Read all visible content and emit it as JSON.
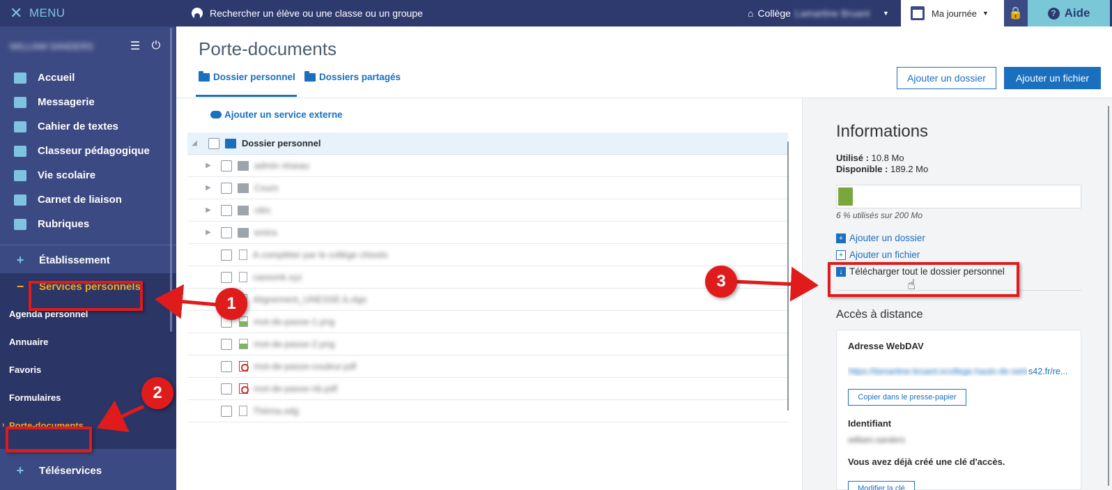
{
  "sidebar": {
    "menu_label": "MENU",
    "user_name": "WILLIAM SANDERS",
    "nav_items": [
      {
        "label": "Accueil",
        "icon": "grid-icon"
      },
      {
        "label": "Messagerie",
        "icon": "envelope-icon"
      },
      {
        "label": "Cahier de textes",
        "icon": "notebook-icon"
      },
      {
        "label": "Classeur pédagogique",
        "icon": "binder-icon"
      },
      {
        "label": "Vie scolaire",
        "icon": "pie-icon"
      },
      {
        "label": "Carnet de liaison",
        "icon": "link-icon"
      },
      {
        "label": "Rubriques",
        "icon": "chat-icon"
      }
    ],
    "etablissement": "Établissement",
    "services_personnels": "Services personnels",
    "sub_items": [
      "Agenda personnel",
      "Annuaire",
      "Favoris",
      "Formulaires",
      "Porte-documents"
    ],
    "teleservices": "Téléservices"
  },
  "topbar": {
    "search_placeholder": "Rechercher un élève ou une classe ou un groupe",
    "college_label": "Collège",
    "college_name": "Lamartine Bruant",
    "journee_label": "Ma journée",
    "aide_label": "Aide"
  },
  "main": {
    "page_title": "Porte-documents",
    "tab_personal": "Dossier personnel",
    "tab_shared": "Dossiers partagés",
    "btn_add_folder": "Ajouter un dossier",
    "btn_add_file": "Ajouter un fichier",
    "add_external": "Ajouter un service externe",
    "root_folder": "Dossier personnel",
    "rows": [
      {
        "type": "folder",
        "name": "admin réseau",
        "expandable": true
      },
      {
        "type": "folder",
        "name": "Cours",
        "expandable": true
      },
      {
        "type": "folder",
        "name": "clés",
        "expandable": true
      },
      {
        "type": "folder",
        "name": "emira",
        "expandable": true
      },
      {
        "type": "doc",
        "name": "A compléter par le collège chiosts",
        "expandable": false
      },
      {
        "type": "doc",
        "name": "cassonk.xyz",
        "expandable": false
      },
      {
        "type": "doc",
        "name": "Alignement_UNESSE.b.xlgs",
        "expandable": false
      },
      {
        "type": "img",
        "name": "mot-de-passe-1.png",
        "expandable": false
      },
      {
        "type": "img",
        "name": "mot-de-passe-2.png",
        "expandable": false
      },
      {
        "type": "pdf",
        "name": "mot-de-passe-couleur.pdf",
        "expandable": false
      },
      {
        "type": "pdf",
        "name": "mot-de-passe-nb.pdf",
        "expandable": false
      },
      {
        "type": "doc",
        "name": "Théma.odg",
        "expandable": false
      }
    ]
  },
  "info": {
    "title": "Informations",
    "used_label": "Utilisé :",
    "used_value": "10.8 Mo",
    "available_label": "Disponible :",
    "available_value": "189.2 Mo",
    "usage_fraction": 0.06,
    "usage_caption": "6 % utilisés sur 200 Mo",
    "link_add_folder": "Ajouter un dossier",
    "link_add_file": "Ajouter un fichier",
    "link_download_all": "Télécharger tout le dossier personnel",
    "remote_title": "Accès à distance",
    "webdav_label": "Adresse WebDAV",
    "webdav_url_hidden": "https://lamartine-bruant.ecollege.hauts-de-seine.fr/ca",
    "webdav_url_visible": "s42.fr/re...",
    "copy_btn": "Copier dans le presse-papier",
    "identifiant_label": "Identifiant",
    "identifiant_value": "william.sanders",
    "key_notice": "Vous avez déjà créé une clé d'accès.",
    "modify_key_btn": "Modifier la clé"
  },
  "annotations": {
    "n1": "1",
    "n2": "2",
    "n3": "3"
  },
  "colors": {
    "accent": "#1a6fbf",
    "sidebar": "#3b4a82",
    "highlight": "#f5a623",
    "annotation": "#e01b1b",
    "usage_bar": "#7aa73c"
  }
}
